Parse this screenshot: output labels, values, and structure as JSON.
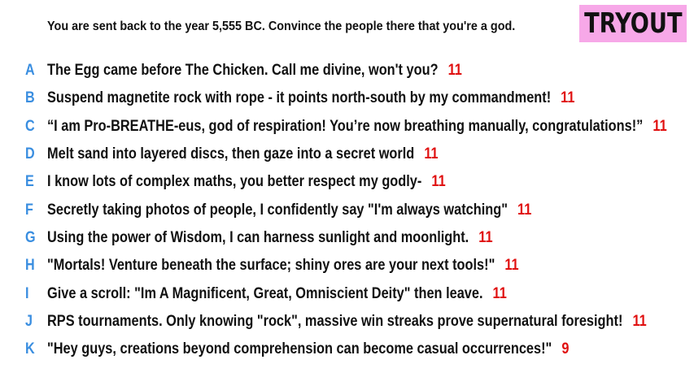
{
  "header": {
    "prompt": "You are sent back to the year 5,555 BC. Convince the people there that you're a god.",
    "badge": "TRYOUT"
  },
  "colors": {
    "letter": "#3a8ee0",
    "score": "#e01010",
    "badge_bg": "#f7a8e8",
    "text": "#111111"
  },
  "answers": [
    {
      "letter": "A",
      "text": "The Egg came before The Chicken. Call me divine, won't you?",
      "score": "11"
    },
    {
      "letter": "B",
      "text": "Suspend magnetite rock with rope - it points north-south by my commandment!",
      "score": "11"
    },
    {
      "letter": "C",
      "text": "“I am Pro-BREATHE-eus, god of respiration! You’re now breathing manually, congratulations!”",
      "score": "11"
    },
    {
      "letter": "D",
      "text": "Melt sand into layered discs, then gaze into a secret world",
      "score": "11"
    },
    {
      "letter": "E",
      "text": "I know lots of complex maths, you better respect my godly-",
      "score": "11"
    },
    {
      "letter": "F",
      "text": "Secretly taking photos of people, I confidently say \"I'm always watching\"",
      "score": "11"
    },
    {
      "letter": "G",
      "text": "Using the power of Wisdom, I can harness sunlight and moonlight.",
      "score": "11"
    },
    {
      "letter": "H",
      "text": "\"Mortals! Venture beneath the surface; shiny ores are your next tools!\"",
      "score": "11"
    },
    {
      "letter": "I",
      "text": "Give a scroll: \"Im A Magnificent, Great, Omniscient Deity\" then leave.",
      "score": "11"
    },
    {
      "letter": "J",
      "text": "RPS tournaments. Only knowing \"rock\", massive win streaks prove supernatural foresight!",
      "score": "11"
    },
    {
      "letter": "K",
      "text": "\"Hey guys, creations beyond comprehension can become casual occurrences!\"",
      "score": "9"
    }
  ]
}
